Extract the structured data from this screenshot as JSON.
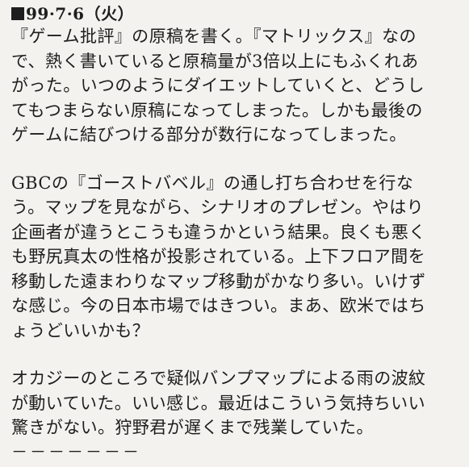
{
  "entry": {
    "date": "99·7·6（火）"
  },
  "paragraphs": [
    {
      "lines": [
        "『ゲーム批評』の原稿を書く。『マトリックス』なの",
        "で、熱く書いていると原稿量が3倍以上にもふくれあ",
        "がった。いつのようにダイエットしていくと、どうし",
        "てもつまらない原稿になってしまった。しかも最後の",
        "ゲームに結びつける部分が数行になってしまった。"
      ]
    },
    {
      "lines": [
        "GBCの『ゴーストバベル』の通し打ち合わせを行な",
        "う。マップを見ながら、シナリオのプレゼン。やはり",
        "企画者が違うとこうも違うかという結果。良くも悪く",
        "も野尻真太の性格が投影されている。上下フロア間を",
        "移動した遠まわりなマップ移動がかなり多い。いけず",
        "な感じ。今の日本市場ではきつい。まあ、欧米ではち",
        "ょうどいいかも？"
      ]
    },
    {
      "lines": [
        "オカジーのところで疑似バンプマップによる雨の波紋",
        "が動いていた。いい感じ。最近はこういう気持ちいい",
        "驚きがない。狩野君が遅くまで残業していた。"
      ]
    }
  ],
  "separator": "－－－－－－－"
}
